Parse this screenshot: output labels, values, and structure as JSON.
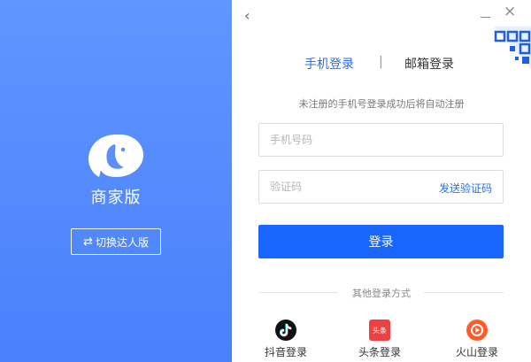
{
  "brand": {
    "name": "商家版",
    "switch_label": "切换达人版",
    "switch_icon": "swap-arrows-icon",
    "gradient_top": "#5f96ff",
    "gradient_bottom": "#4a80fb"
  },
  "window": {
    "back_icon": "‹",
    "close_icon": "×"
  },
  "tabs": [
    {
      "label": "手机登录",
      "active": true
    },
    {
      "label": "邮箱登录",
      "active": false
    }
  ],
  "tab_divider": "|",
  "notice": "未注册的手机号登录成功后将自动注册",
  "form": {
    "phone_placeholder": "手机号码",
    "phone_value": "",
    "code_placeholder": "验证码",
    "code_value": "",
    "send_code_label": "发送验证码",
    "login_label": "登录"
  },
  "other_login": {
    "title": "其他登录方式",
    "providers": [
      {
        "label": "抖音登录",
        "icon": "douyin-icon"
      },
      {
        "label": "头条登录",
        "icon": "toutiao-icon",
        "icon_text": "头条"
      },
      {
        "label": "火山登录",
        "icon": "huoshan-icon"
      }
    ]
  },
  "colors": {
    "accent": "#1966ff",
    "link": "#2a6ff5"
  }
}
